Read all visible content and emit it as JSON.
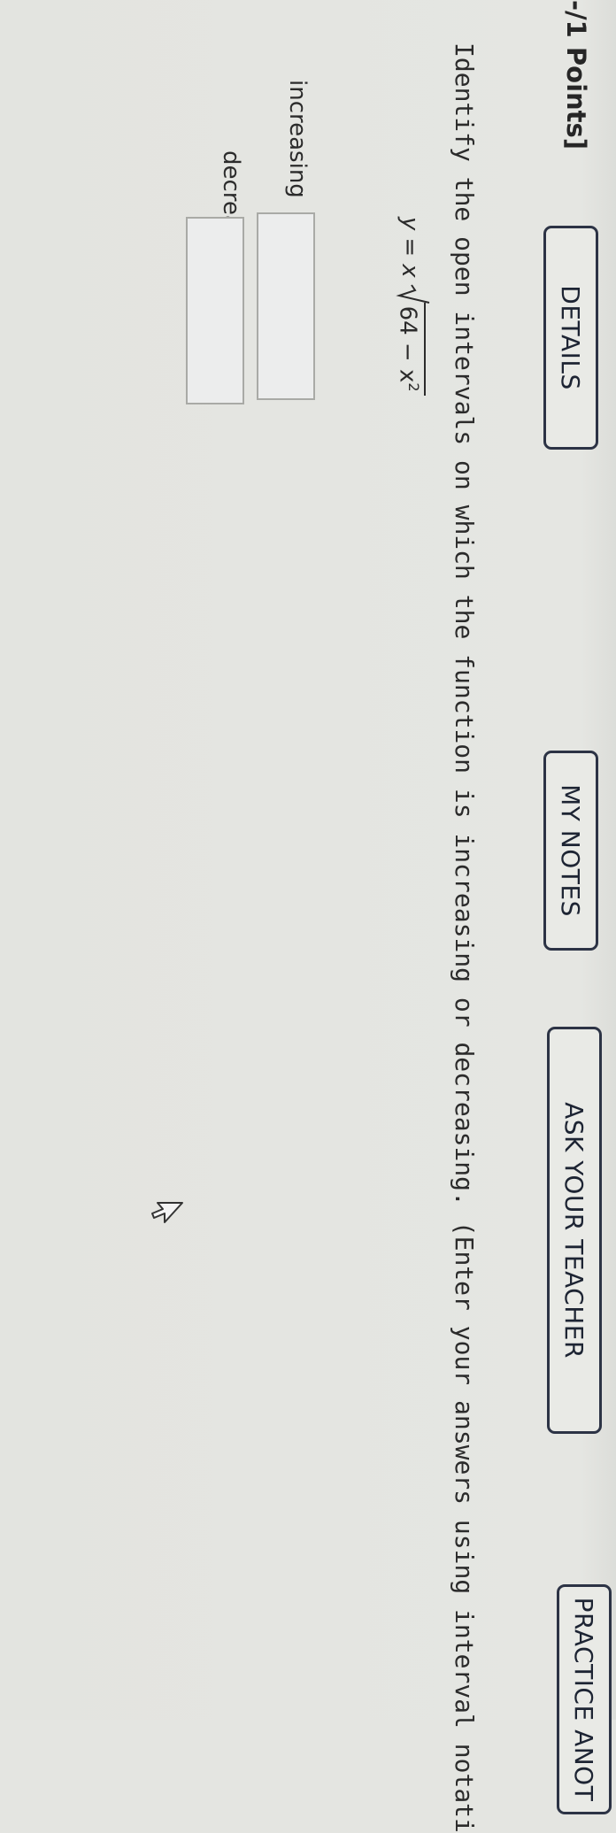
{
  "header": {
    "points_label": "-/1 Points]",
    "buttons": {
      "details": "DETAILS",
      "my_notes": "MY NOTES",
      "ask_teacher": "ASK YOUR TEACHER",
      "practice_another": "PRACTICE ANOT"
    }
  },
  "question": {
    "instruction": "Identify the open intervals on which the function is increasing or decreasing. (Enter your answers using interval notati",
    "equation": {
      "lhs": "y",
      "eq": "=",
      "factor": "x",
      "radicand": "64 − x",
      "exponent": "2"
    },
    "fields": {
      "increasing_label": "increasing",
      "decreasing_label": "decreasing",
      "increasing_value": "",
      "decreasing_value": ""
    }
  },
  "icons": {
    "cursor": "mouse-pointer-icon"
  }
}
